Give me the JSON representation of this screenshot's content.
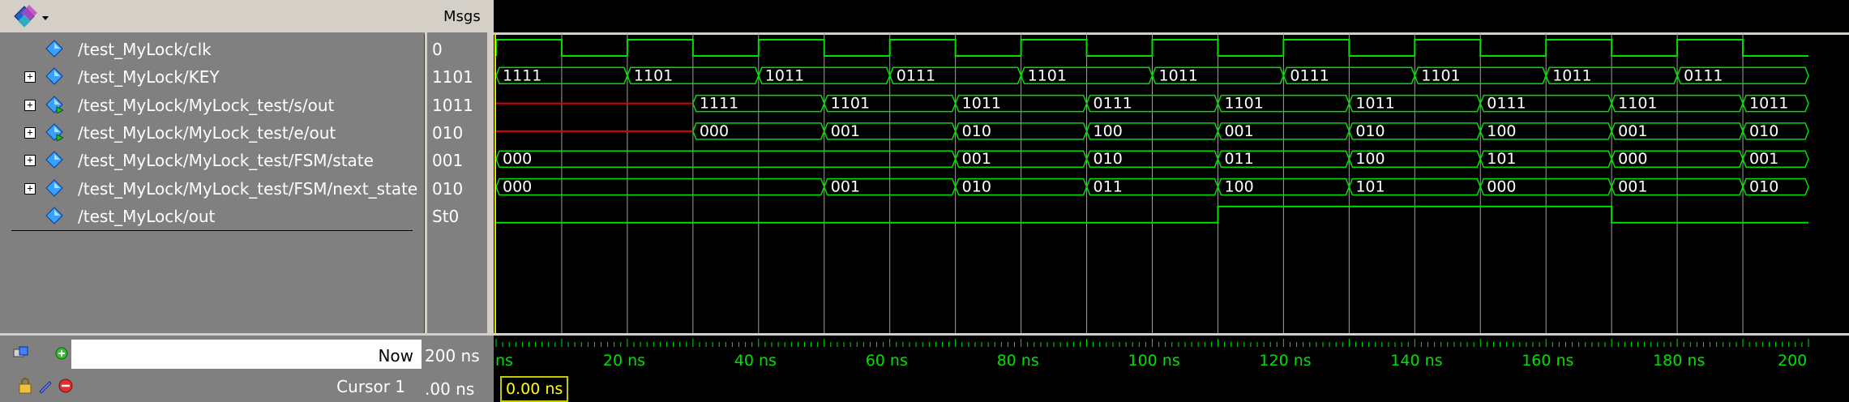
{
  "header": {
    "tool_dropdown_icon": "diamond-dropdown-icon",
    "msgs_label": "Msgs"
  },
  "signals": [
    {
      "name": "/test_MyLock/clk",
      "msg": "0",
      "expandable": false,
      "kind": "in"
    },
    {
      "name": "/test_MyLock/KEY",
      "msg": "1101",
      "expandable": true,
      "kind": "in"
    },
    {
      "name": "/test_MyLock/MyLock_test/s/out",
      "msg": "1011",
      "expandable": true,
      "kind": "out"
    },
    {
      "name": "/test_MyLock/MyLock_test/e/out",
      "msg": "010",
      "expandable": true,
      "kind": "out"
    },
    {
      "name": "/test_MyLock/MyLock_test/FSM/state",
      "msg": "001",
      "expandable": true,
      "kind": "in"
    },
    {
      "name": "/test_MyLock/MyLock_test/FSM/next_state",
      "msg": "010",
      "expandable": true,
      "kind": "in"
    },
    {
      "name": "/test_MyLock/out",
      "msg": "St0",
      "expandable": false,
      "kind": "in"
    }
  ],
  "waves": {
    "time_max_ns": 200,
    "clk_period_ns": 20,
    "KEY": [
      {
        "t": 0,
        "v": "1111"
      },
      {
        "t": 20,
        "v": "1101"
      },
      {
        "t": 40,
        "v": "1011"
      },
      {
        "t": 60,
        "v": "0111"
      },
      {
        "t": 80,
        "v": "1101"
      },
      {
        "t": 100,
        "v": "1011"
      },
      {
        "t": 120,
        "v": "0111"
      },
      {
        "t": 140,
        "v": "1101"
      },
      {
        "t": 160,
        "v": "1011"
      },
      {
        "t": 180,
        "v": "0111"
      }
    ],
    "s_out": [
      {
        "t": 30,
        "v": "1111"
      },
      {
        "t": 50,
        "v": "1101"
      },
      {
        "t": 70,
        "v": "1011"
      },
      {
        "t": 90,
        "v": "0111"
      },
      {
        "t": 110,
        "v": "1101"
      },
      {
        "t": 130,
        "v": "1011"
      },
      {
        "t": 150,
        "v": "0111"
      },
      {
        "t": 170,
        "v": "1101"
      },
      {
        "t": 190,
        "v": "1011"
      }
    ],
    "s_out_undefined_until": 30,
    "e_out": [
      {
        "t": 30,
        "v": "000"
      },
      {
        "t": 50,
        "v": "001"
      },
      {
        "t": 70,
        "v": "010"
      },
      {
        "t": 90,
        "v": "100"
      },
      {
        "t": 110,
        "v": "001"
      },
      {
        "t": 130,
        "v": "010"
      },
      {
        "t": 150,
        "v": "100"
      },
      {
        "t": 170,
        "v": "001"
      },
      {
        "t": 190,
        "v": "010"
      }
    ],
    "e_out_undefined_until": 30,
    "state": [
      {
        "t": 0,
        "v": "000"
      },
      {
        "t": 70,
        "v": "001"
      },
      {
        "t": 90,
        "v": "010"
      },
      {
        "t": 110,
        "v": "011"
      },
      {
        "t": 130,
        "v": "100"
      },
      {
        "t": 150,
        "v": "101"
      },
      {
        "t": 170,
        "v": "000"
      },
      {
        "t": 190,
        "v": "001"
      }
    ],
    "next_state": [
      {
        "t": 0,
        "v": "000"
      },
      {
        "t": 50,
        "v": "001"
      },
      {
        "t": 70,
        "v": "010"
      },
      {
        "t": 90,
        "v": "011"
      },
      {
        "t": 110,
        "v": "100"
      },
      {
        "t": 130,
        "v": "101"
      },
      {
        "t": 150,
        "v": "000"
      },
      {
        "t": 170,
        "v": "001"
      },
      {
        "t": 190,
        "v": "010"
      }
    ],
    "out": [
      {
        "t": 0,
        "v": 0
      },
      {
        "t": 110,
        "v": 1
      },
      {
        "t": 170,
        "v": 0
      }
    ]
  },
  "bottom": {
    "now_label": "Now",
    "now_value": "200 ns",
    "cursor_label": "Cursor 1",
    "cursor_value": ".00 ns",
    "cursor_box": "0.00 ns"
  },
  "timeline": {
    "labels": [
      {
        "t": 0,
        "text": "ns"
      },
      {
        "t": 20,
        "text": "20 ns"
      },
      {
        "t": 40,
        "text": "40 ns"
      },
      {
        "t": 60,
        "text": "60 ns"
      },
      {
        "t": 80,
        "text": "80 ns"
      },
      {
        "t": 100,
        "text": "100 ns"
      },
      {
        "t": 120,
        "text": "120 ns"
      },
      {
        "t": 140,
        "text": "140 ns"
      },
      {
        "t": 160,
        "text": "160 ns"
      },
      {
        "t": 180,
        "text": "180 ns"
      },
      {
        "t": 200,
        "text": "200"
      }
    ]
  },
  "colors": {
    "wave": "#00e000",
    "undefined": "#e00000",
    "grid": "#a0a0a0",
    "cursor": "#e0e000",
    "timeline": "#00e000"
  }
}
